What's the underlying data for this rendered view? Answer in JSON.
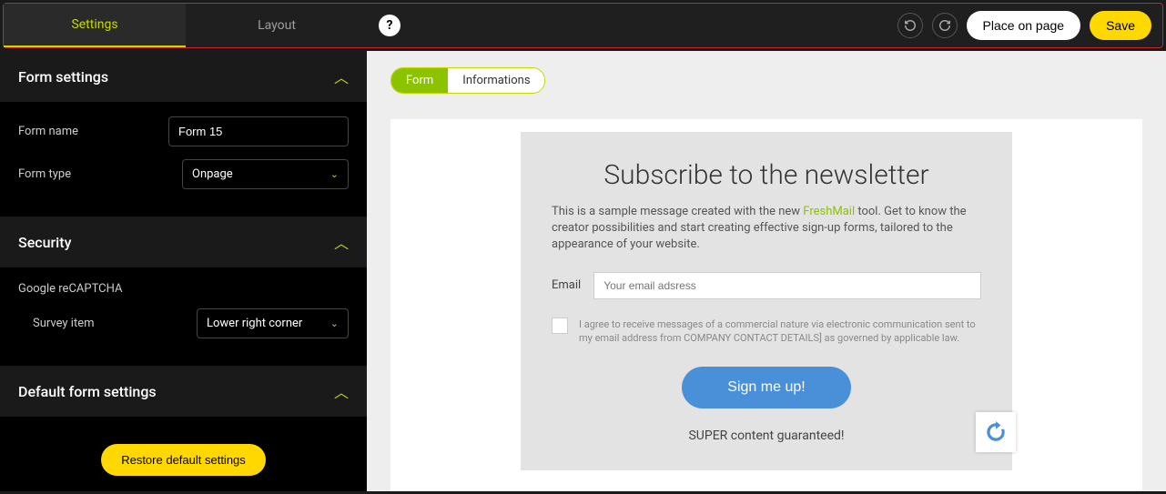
{
  "topbar": {
    "tabs": {
      "settings": "Settings",
      "layout": "Layout"
    },
    "help": "?",
    "place_label": "Place on page",
    "save_label": "Save"
  },
  "sidebar": {
    "form_settings": {
      "title": "Form settings",
      "name_label": "Form name",
      "name_value": "Form 15",
      "type_label": "Form type",
      "type_value": "Onpage"
    },
    "security": {
      "title": "Security",
      "recaptcha_label": "Google reCAPTCHA",
      "survey_label": "Survey item",
      "survey_value": "Lower right corner"
    },
    "defaults": {
      "title": "Default form settings",
      "restore_label": "Restore default settings"
    }
  },
  "canvas": {
    "tabs": {
      "form": "Form",
      "info": "Informations"
    },
    "heading": "Subscribe to the newsletter",
    "desc_pre": "This is a sample message created with the new ",
    "desc_brand": "FreshMail",
    "desc_post": " tool. Get to know the creator possibilities and start creating effective sign-up forms, tailored to the appearance of your website.",
    "email_label": "Email",
    "email_placeholder": "Your email adsress",
    "consent_text": "I agree to receive messages of a commercial nature via electronic communication sent to my email address from COMPANY CONTACT DETAILS] as governed by applicable law.",
    "signup_label": "Sign me up!",
    "guarantee": "SUPER content guaranteed!"
  }
}
